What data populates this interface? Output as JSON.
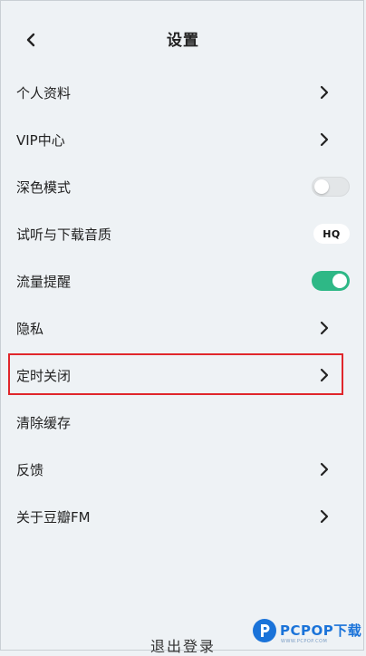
{
  "header": {
    "title": "设置",
    "back_icon": "chevron-left-icon"
  },
  "settings": [
    {
      "label": "个人资料",
      "control": "chevron"
    },
    {
      "label": "VIP中心",
      "control": "chevron"
    },
    {
      "label": "深色模式",
      "control": "toggle",
      "toggle_on": false
    },
    {
      "label": "试听与下载音质",
      "control": "badge",
      "badge": "HQ"
    },
    {
      "label": "流量提醒",
      "control": "toggle",
      "toggle_on": true
    },
    {
      "label": "隐私",
      "control": "chevron"
    },
    {
      "label": "定时关闭",
      "control": "chevron",
      "highlighted": true
    },
    {
      "label": "清除缓存",
      "control": "none"
    },
    {
      "label": "反馈",
      "control": "chevron"
    },
    {
      "label": "关于豆瓣FM",
      "control": "chevron"
    }
  ],
  "logout_label": "退出登录",
  "colors": {
    "toggle_on": "#2eb886",
    "highlight": "#e0262b",
    "background": "#eef2f5"
  },
  "watermark": {
    "text": "PCPOP下载",
    "sub": "WWW.PCPOP.COM"
  }
}
